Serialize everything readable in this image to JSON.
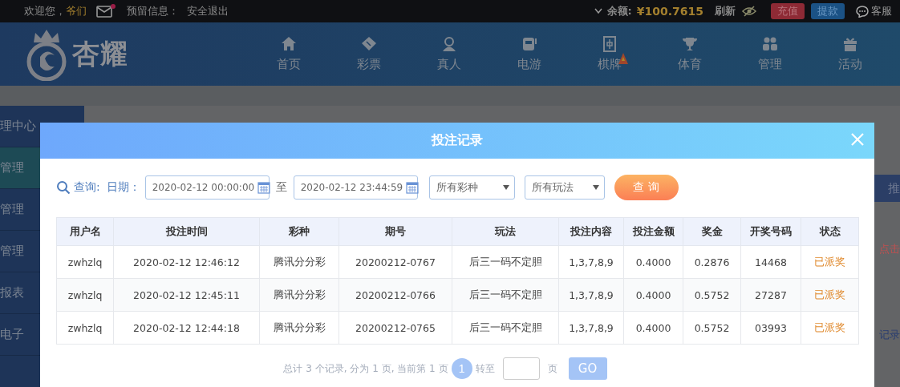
{
  "top_bar": {
    "welcome": "欢迎您，",
    "user": "爷们",
    "mail_unread": true,
    "reserved_info": "预留信息：",
    "logout": "安全退出",
    "balance_label": "余额:",
    "balance": "¥100.7615",
    "refresh": "刷新",
    "deposit": "充值",
    "withdraw": "提款",
    "service": "客服"
  },
  "logo": {
    "text": "杏耀"
  },
  "nav": [
    {
      "label": "首页",
      "kind": "home"
    },
    {
      "label": "彩票",
      "kind": "ticket"
    },
    {
      "label": "真人",
      "kind": "person"
    },
    {
      "label": "电游",
      "kind": "slot"
    },
    {
      "label": "棋牌",
      "kind": "mahjong",
      "badge": true
    },
    {
      "label": "体育",
      "kind": "trophy"
    },
    {
      "label": "管理",
      "kind": "people"
    },
    {
      "label": "活动",
      "kind": "gift"
    }
  ],
  "sidebar": {
    "items": [
      {
        "label": "理中心",
        "selected": false
      },
      {
        "label": "管理",
        "selected": true
      },
      {
        "label": "管理",
        "selected": false
      },
      {
        "label": "管理",
        "selected": false
      },
      {
        "label": "报表",
        "selected": false
      },
      {
        "label": "电子",
        "selected": false
      }
    ]
  },
  "background_fragments": {
    "tab": "推",
    "notice": "点击",
    "link": "记录"
  },
  "modal": {
    "title": "投注记录",
    "query": {
      "label": "查询:",
      "date_label": "日期：",
      "start": "2020-02-12 00:00:00",
      "to": "至",
      "end": "2020-02-12 23:44:59",
      "lottery_select": "所有彩种",
      "play_select": "所有玩法",
      "button": "查 询"
    },
    "table": {
      "columns": [
        "用户名",
        "投注时间",
        "彩种",
        "期号",
        "玩法",
        "投注内容",
        "投注金额",
        "奖金",
        "开奖号码",
        "状态"
      ],
      "rows": [
        [
          "zwhzlq",
          "2020-02-12 12:46:12",
          "腾讯分分彩",
          "20200212-0767",
          "后三一码不定胆",
          "1,3,7,8,9",
          "0.4000",
          "0.2876",
          "14468",
          "已派奖"
        ],
        [
          "zwhzlq",
          "2020-02-12 12:45:11",
          "腾讯分分彩",
          "20200212-0766",
          "后三一码不定胆",
          "1,3,7,8,9",
          "0.4000",
          "0.5752",
          "27287",
          "已派奖"
        ],
        [
          "zwhzlq",
          "2020-02-12 12:44:18",
          "腾讯分分彩",
          "20200212-0765",
          "后三一码不定胆",
          "1,3,7,8,9",
          "0.4000",
          "0.5752",
          "03993",
          "已派奖"
        ]
      ]
    },
    "pagination": {
      "summary": "总计 3 个记录, 分为 1 页, 当前第 1 页",
      "pages": [
        {
          "label": "1",
          "selected": true
        }
      ],
      "goto": "转至",
      "page_unit": "页",
      "go": "GO"
    }
  }
}
